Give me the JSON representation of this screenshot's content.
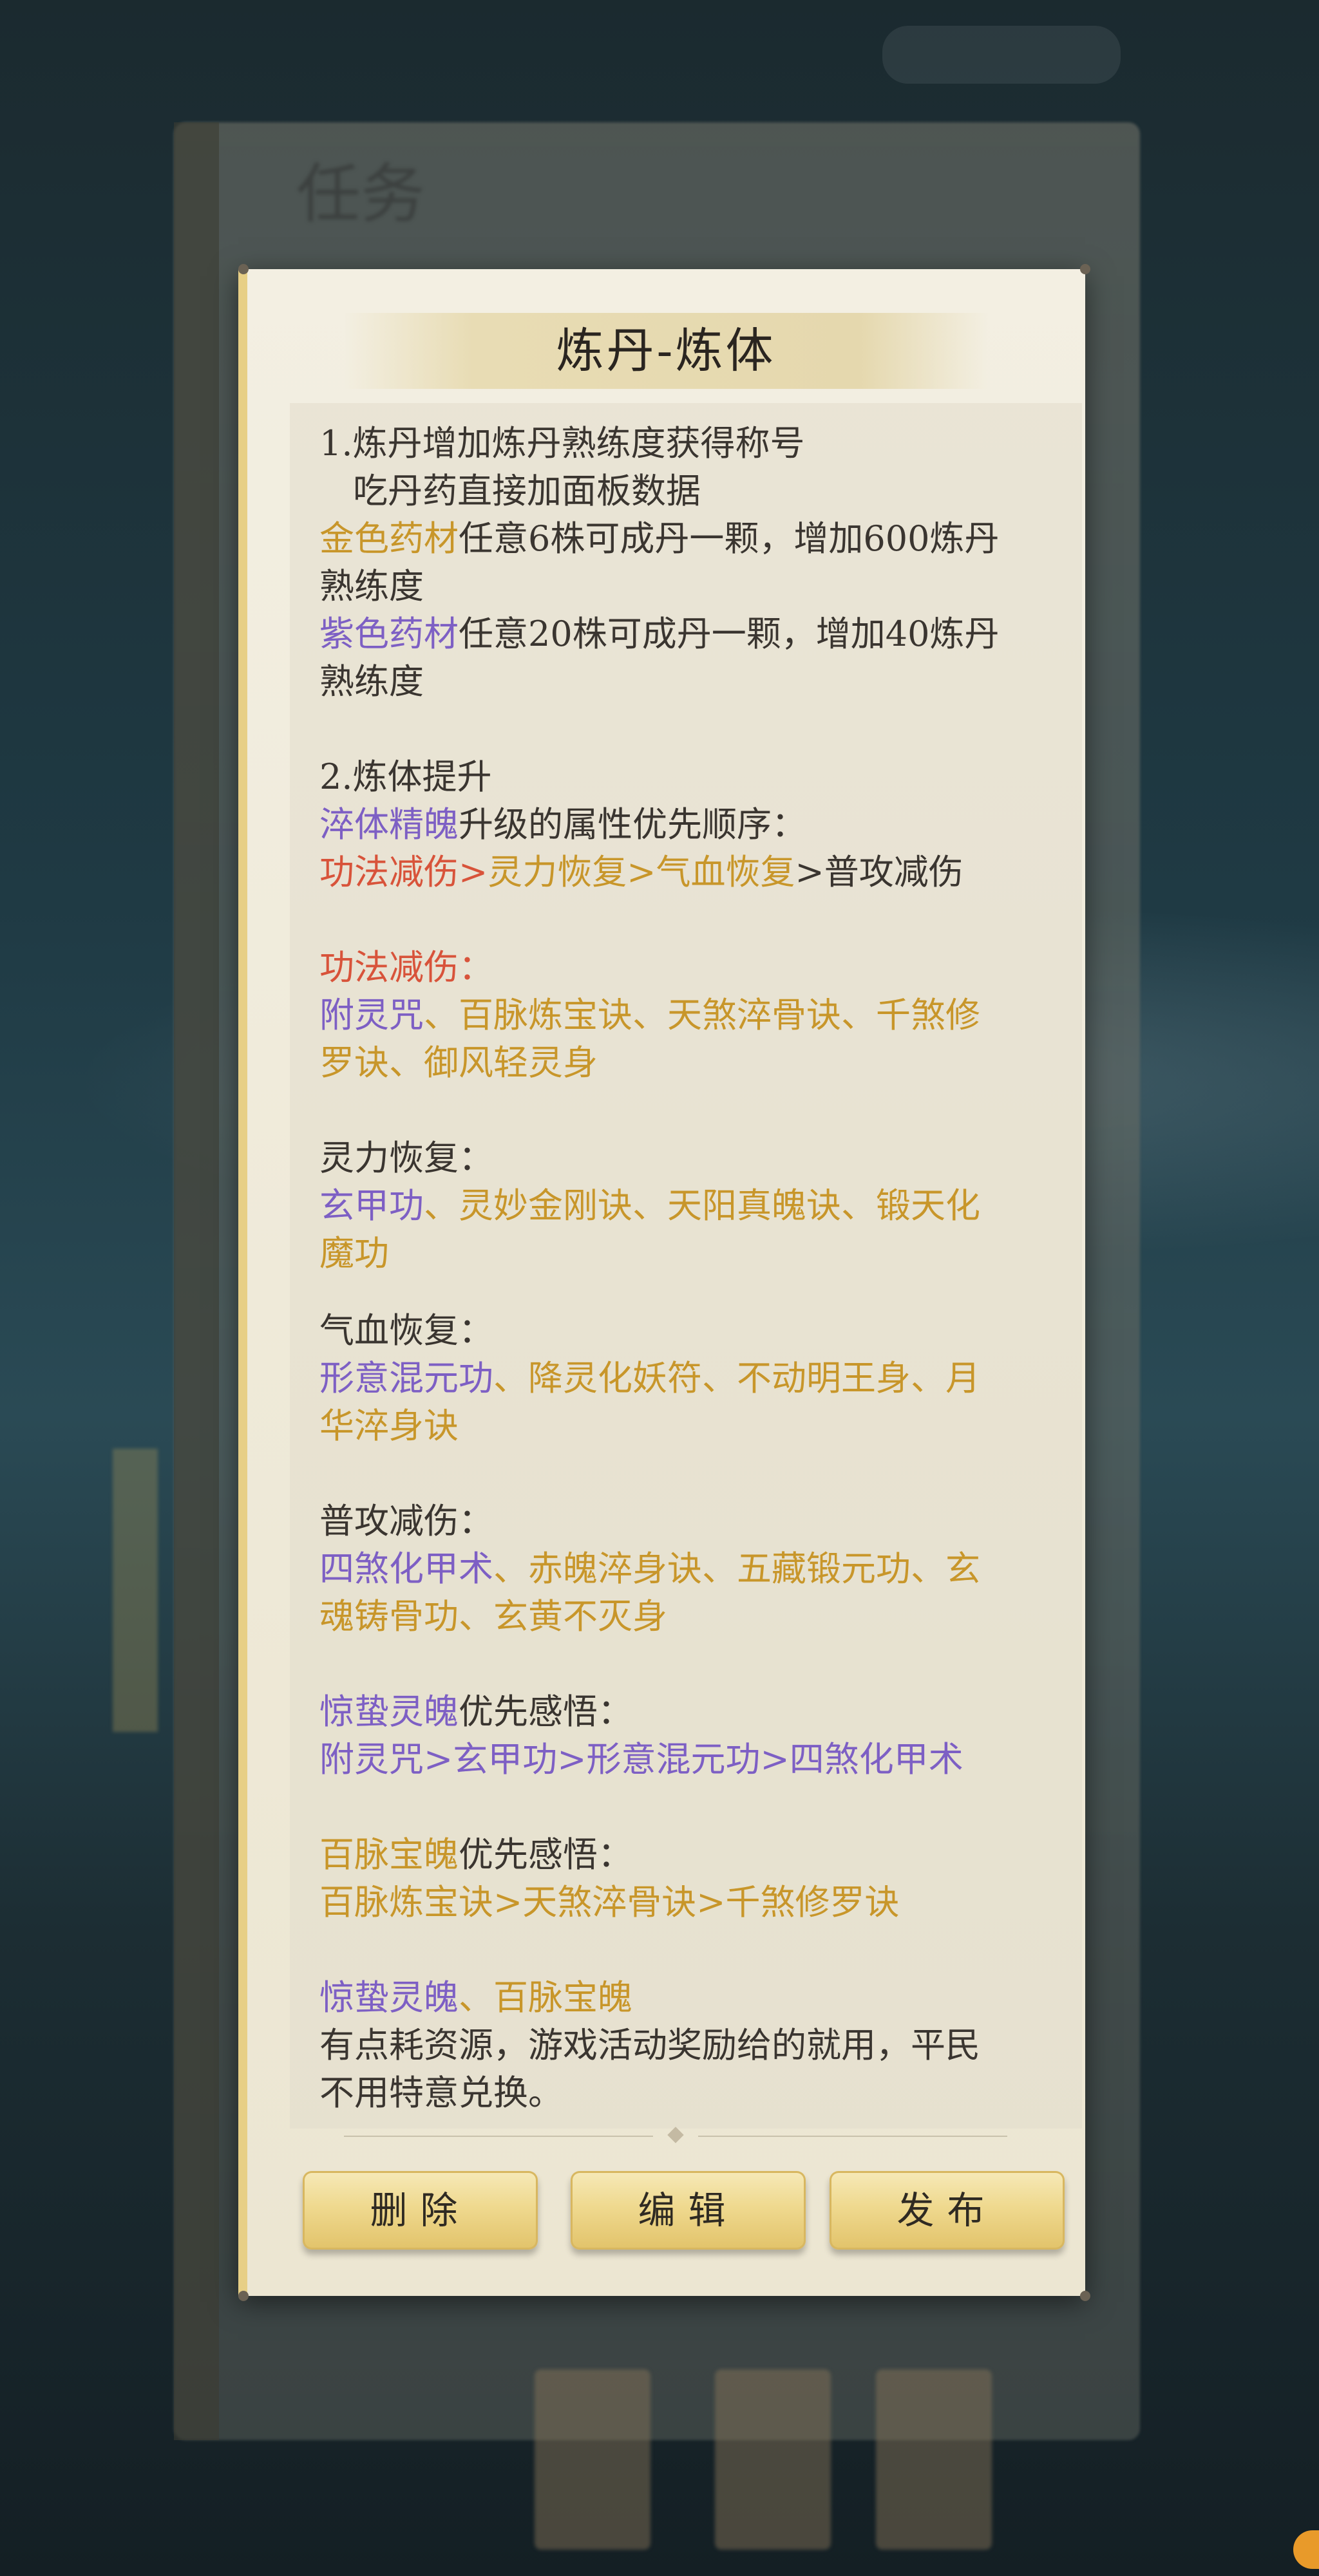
{
  "background": {
    "book_title": "任务"
  },
  "dialog": {
    "title": "炼丹-炼体",
    "lines": {
      "l1": "1.炼丹增加炼丹熟练度获得称号",
      "l2": "吃丹药直接加面板数据",
      "l3a": "金色药材",
      "l3b": "任意6株可成丹一颗，增加600炼丹",
      "l4": "熟练度",
      "l5a": "紫色药材",
      "l5b": "任意20株可成丹一颗，增加40炼丹",
      "l6": "熟练度",
      "l7": "2.炼体提升",
      "l8a": "淬体精魄",
      "l8b": "升级的属性优先顺序：",
      "l9a": "功法减伤>",
      "l9b": "灵力恢复>",
      "l9c": "气血恢复",
      "l9d": ">普攻减伤",
      "l10": "功法减伤：",
      "l11a": "附灵咒",
      "l11b": "、",
      "l11c": "百脉炼宝诀、天煞淬骨诀、千煞修",
      "l12": "罗诀、御风轻灵身",
      "l13": "灵力恢复：",
      "l14a": "玄甲功",
      "l14b": "、灵妙金刚诀、天阳真魄诀、锻天化",
      "l15": "魔功",
      "l16": "气血恢复：",
      "l17a": "形意混元功",
      "l17b": "、降灵化妖符、不动明王身、月",
      "l18": "华淬身诀",
      "l19": "普攻减伤：",
      "l20a": "四煞化甲术",
      "l20b": "、赤魄淬身诀、五藏锻元功、玄",
      "l21": "魂铸骨功、玄黄不灭身",
      "l22a": "惊蛰灵魄",
      "l22b": "优先感悟：",
      "l23": "附灵咒>玄甲功>形意混元功>四煞化甲术",
      "l24a": "百脉宝魄",
      "l24b": "优先感悟：",
      "l25": "百脉炼宝诀>天煞淬骨诀>千煞修罗诀",
      "l26a": "惊蛰灵魄",
      "l26b": "、百脉宝魄",
      "l27": "有点耗资源，游戏活动奖励给的就用，平民",
      "l28": "不用特意兑换。"
    },
    "buttons": {
      "delete": "删除",
      "edit": "编辑",
      "publish": "发布"
    }
  },
  "colors": {
    "gold": "#c8962a",
    "purple": "#7d5fc4",
    "red": "#d8533a",
    "text": "#3a3530"
  }
}
